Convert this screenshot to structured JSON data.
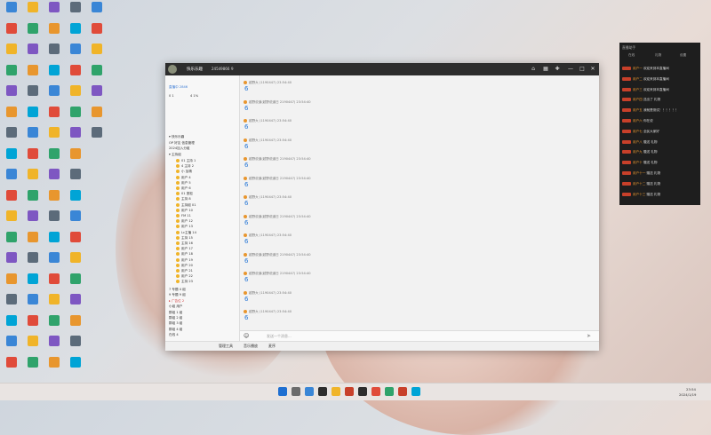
{
  "window": {
    "title": "快乐乐趣",
    "id": "24549866",
    "online_count": "9",
    "controls": {
      "minimize": "—",
      "maximize": "□",
      "close": "✕"
    }
  },
  "sidebar": {
    "header": "直播中 2846",
    "stats": [
      "0 1",
      "4 1%"
    ],
    "groups": [
      {
        "label": "▾ 快乐乐趣"
      },
      {
        "label": "OP 好友 信息管理"
      },
      {
        "label": "2024加入分组"
      },
      {
        "label": "▾ 主持组"
      }
    ],
    "members": [
      "01 主持 1",
      "4 主持 2",
      "小 加精",
      "用户 4",
      "用户 5",
      "用户 6",
      "01 宽松",
      "主持 8",
      "主持组 01",
      "用户 10",
      "FM 11",
      "用户 12",
      "用户 13",
      "Lc主播 14",
      "主持 15",
      "主持 16",
      "用户 17",
      "用户 18",
      "用户 19",
      "用户 20",
      "用户 21",
      "用户 22",
      "主持 23"
    ],
    "bottom_groups": [
      "7 专题 4 组",
      "9 专题 9 组",
      "▸ 广告位 2",
      "小组 用户",
      "群组 1 组",
      "群组 2 组",
      "群组 3 组",
      "群组 4 组",
      "在线 4"
    ]
  },
  "chat": {
    "messages": [
      {
        "header": "越野大 (1190447)  23:54:40",
        "body": "6"
      },
      {
        "header": "越野说道(越野说道日 2190447)  23:54:40",
        "body": "6"
      },
      {
        "header": "越野大 (1190447)  23:54:40",
        "body": "6"
      },
      {
        "header": "越野大 (1190447)  23:54:40",
        "body": "6"
      },
      {
        "header": "越野说道(越野说道日 2190447)  23:54:40",
        "body": "6"
      },
      {
        "header": "越野说道(越野说道日 2190447)  23:54:40",
        "body": "6"
      },
      {
        "header": "越野大 (1190447)  23:54:40",
        "body": "6"
      },
      {
        "header": "越野说道(越野说道日 2190447)  23:54:40",
        "body": "6"
      },
      {
        "header": "越野大 (1190447)  23:54:40",
        "body": "6"
      },
      {
        "header": "越野说道(越野说道日 2190447)  23:54:40",
        "body": "6"
      },
      {
        "header": "越野说道(越野说道日 2190447)  23:54:40",
        "body": "6"
      },
      {
        "header": "越野大 (1190447)  23:54:40",
        "body": "6"
      },
      {
        "header": "越野大 (1190447)  23:54:40",
        "body": "6"
      }
    ],
    "input_placeholder": "发送一个消息..."
  },
  "bottom_bar": {
    "items": [
      "管理工具",
      "音乐播放",
      "麦序"
    ]
  },
  "live_panel": {
    "title": "直播助手",
    "tabs": [
      "在线",
      "礼物",
      "设置"
    ],
    "rows": [
      {
        "name": "用户一",
        "text": "欢迎来到本直播间"
      },
      {
        "name": "用户二",
        "text": "欢迎来到本直播间"
      },
      {
        "name": "用户三",
        "text": "欢迎来到本直播间"
      },
      {
        "name": "用户四",
        "text": "送出了 礼物"
      },
      {
        "name": "用户五",
        "text": "我就是测试！！！！！！"
      },
      {
        "name": "用户六",
        "text": "你在说"
      },
      {
        "name": "用户七",
        "text": "全民大家好"
      },
      {
        "name": "用户八",
        "text": "赠送 礼物"
      },
      {
        "name": "用户九",
        "text": "赠送 礼物"
      },
      {
        "name": "用户十",
        "text": "赠送 礼物"
      },
      {
        "name": "用户十一",
        "text": "赠送 礼物"
      },
      {
        "name": "用户十二",
        "text": "赠送 礼物"
      },
      {
        "name": "用户十三",
        "text": "赠送 礼物"
      }
    ]
  },
  "taskbar": {
    "time": "23:54",
    "date": "2024/1/19"
  },
  "colors": {
    "accent": "#e8962e",
    "chat_text": "#2a78d6",
    "dark": "#1e1e1e",
    "titlebar": "#2d2d2d"
  }
}
